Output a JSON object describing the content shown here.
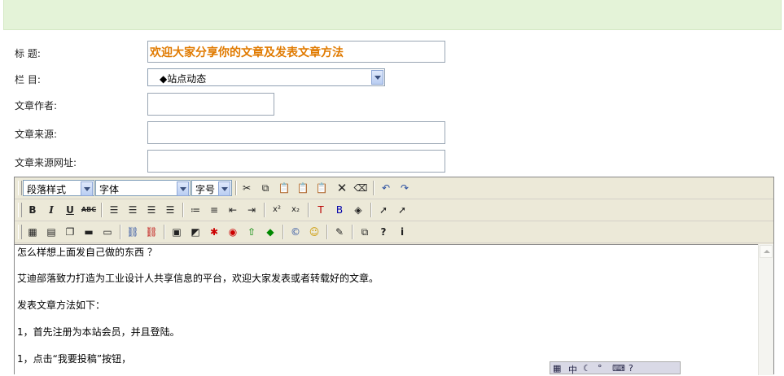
{
  "form": {
    "title_label": "标 题:",
    "title_value": "欢迎大家分享你的文章及发表文章方法",
    "column_label": "栏 目:",
    "column_value": "◆站点动态",
    "author_label": "文章作者:",
    "source_label": "文章来源:",
    "source_url_label": "文章来源网址:"
  },
  "toolbar": {
    "paragraph_style": "段落样式",
    "font": "字体",
    "font_size": "字号",
    "bold": "B",
    "italic": "I",
    "underline": "U",
    "strike": "ABC",
    "superscript": "x²",
    "subscript": "x₂"
  },
  "content": {
    "line1": "怎么样想上面发自己做的东西 ？",
    "line2": "艾迪部落致力打造为工业设计人共享信息的平台，欢迎大家发表或者转载好的文章。",
    "line3": "发表文章方法如下：",
    "line4": "1，首先注册为本站会员，并且登陆。",
    "line5": "1，点击“我要投稿”按钮，"
  },
  "ime": {
    "label": "中"
  }
}
